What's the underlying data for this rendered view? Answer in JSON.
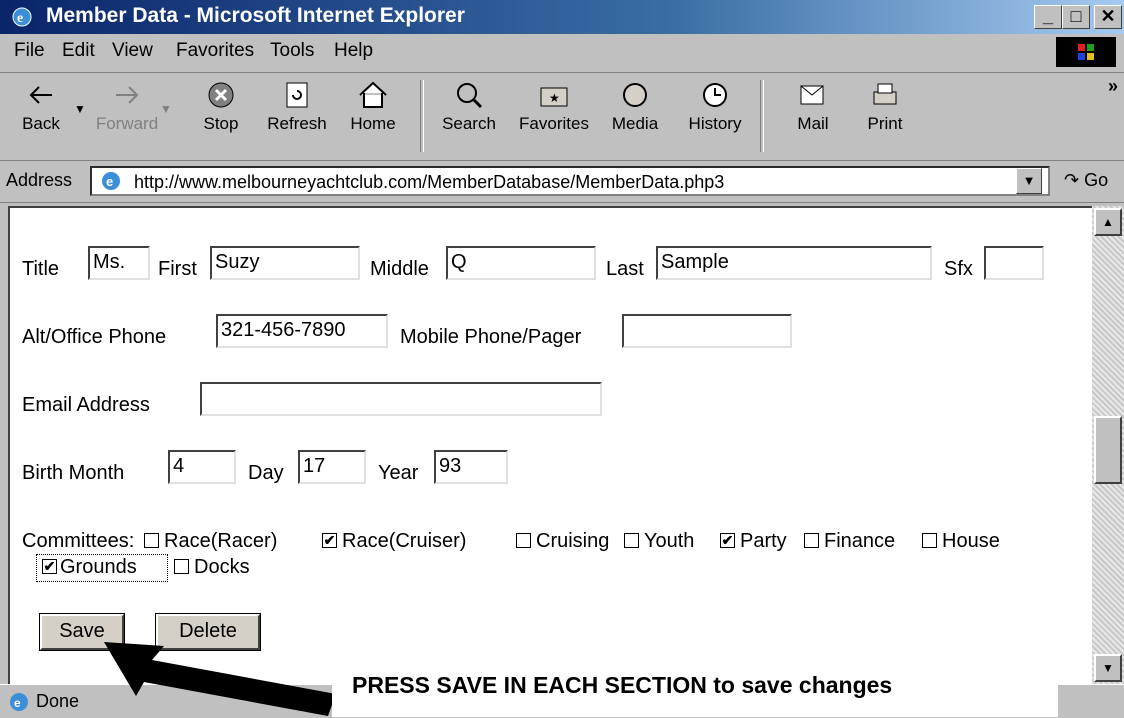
{
  "window": {
    "title": "Member Data - Microsoft Internet Explorer"
  },
  "menu": {
    "items": [
      "File",
      "Edit",
      "View",
      "Favorites",
      "Tools",
      "Help"
    ]
  },
  "toolbar": {
    "back": "Back",
    "forward": "Forward",
    "stop": "Stop",
    "refresh": "Refresh",
    "home": "Home",
    "search": "Search",
    "favorites": "Favorites",
    "media": "Media",
    "history": "History",
    "mail": "Mail",
    "print": "Print",
    "more": "»"
  },
  "address": {
    "label": "Address",
    "url": "http://www.melbourneyachtclub.com/MemberDatabase/MemberData.php3",
    "go": "Go"
  },
  "form": {
    "title_label": "Title",
    "title_value": "Ms.",
    "first_label": "First",
    "first_value": "Suzy",
    "middle_label": "Middle",
    "middle_value": "Q",
    "last_label": "Last",
    "last_value": "Sample",
    "sfx_label": "Sfx",
    "sfx_value": "",
    "alt_phone_label": "Alt/Office Phone",
    "alt_phone_value": "321-456-7890",
    "mobile_label": "Mobile Phone/Pager",
    "mobile_value": "",
    "email_label": "Email Address",
    "email_value": "",
    "birth_month_label": "Birth Month",
    "birth_month_value": "4",
    "day_label": "Day",
    "day_value": "17",
    "year_label": "Year",
    "year_value": "93",
    "committees_label": "Committees:",
    "committees": [
      {
        "label": "Race(Racer)",
        "checked": false
      },
      {
        "label": "Race(Cruiser)",
        "checked": true
      },
      {
        "label": "Cruising",
        "checked": false
      },
      {
        "label": "Youth",
        "checked": false
      },
      {
        "label": "Party",
        "checked": true
      },
      {
        "label": "Finance",
        "checked": false
      },
      {
        "label": "House",
        "checked": false
      },
      {
        "label": "Grounds",
        "checked": true
      },
      {
        "label": "Docks",
        "checked": false
      }
    ],
    "save_label": "Save",
    "delete_label": "Delete"
  },
  "status": {
    "text": "Done"
  },
  "annotation": {
    "text": "PRESS SAVE IN EACH SECTION to save changes"
  }
}
